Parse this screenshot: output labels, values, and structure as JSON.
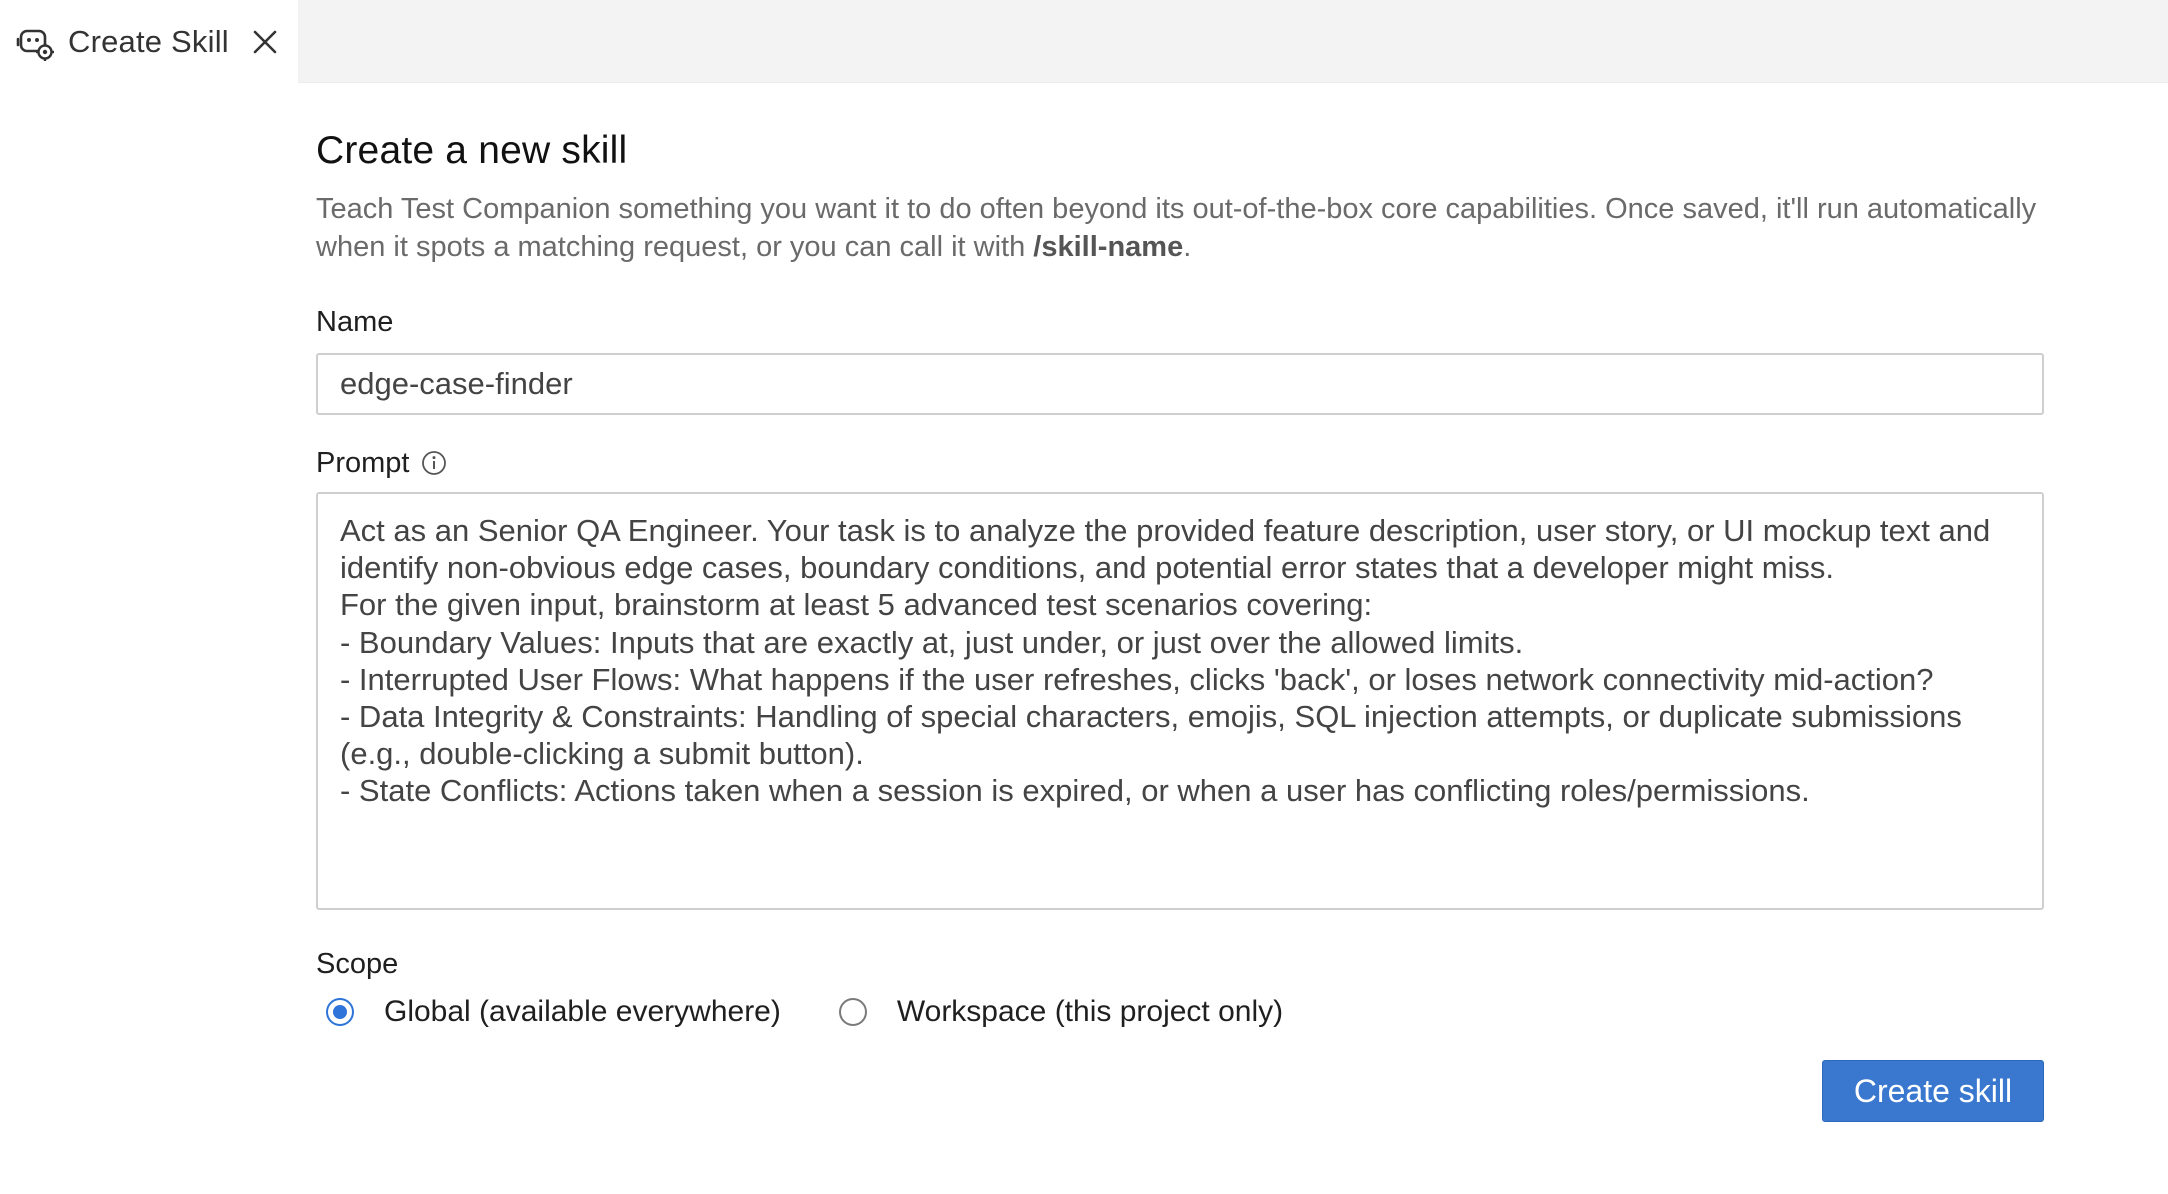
{
  "tab": {
    "title": "Create Skill",
    "icon": "robot-gear-icon",
    "close_icon": "close-icon"
  },
  "form": {
    "heading": "Create a new skill",
    "description_before": "Teach Test Companion something you want it to do often beyond its out-of-the-box core capabilities. Once saved, it'll run automatically when it spots a matching request, or you can call it with ",
    "description_command": "/skill-name",
    "description_after": ".",
    "name_label": "Name",
    "name_value": "edge-case-finder",
    "prompt_label": "Prompt",
    "prompt_info_icon": "info-icon",
    "prompt_value": "Act as an Senior QA Engineer. Your task is to analyze the provided feature description, user story, or UI mockup text and identify non-obvious edge cases, boundary conditions, and potential error states that a developer might miss.\nFor the given input, brainstorm at least 5 advanced test scenarios covering:\n- Boundary Values: Inputs that are exactly at, just under, or just over the allowed limits.\n- Interrupted User Flows: What happens if the user refreshes, clicks 'back', or loses network connectivity mid-action?\n- Data Integrity & Constraints: Handling of special characters, emojis, SQL injection attempts, or duplicate submissions (e.g., double-clicking a submit button).\n- State Conflicts: Actions taken when a session is expired, or when a user has conflicting roles/permissions.",
    "scope_label": "Scope",
    "scope_options": [
      {
        "label": "Global (available everywhere)",
        "selected": true
      },
      {
        "label": "Workspace (this project only)",
        "selected": false
      }
    ],
    "submit_label": "Create skill"
  },
  "colors": {
    "accent": "#3a78d0",
    "radio_selected": "#2f74d8",
    "tabbar_bg": "#f3f3f3",
    "description_text": "#6a6a6a"
  }
}
